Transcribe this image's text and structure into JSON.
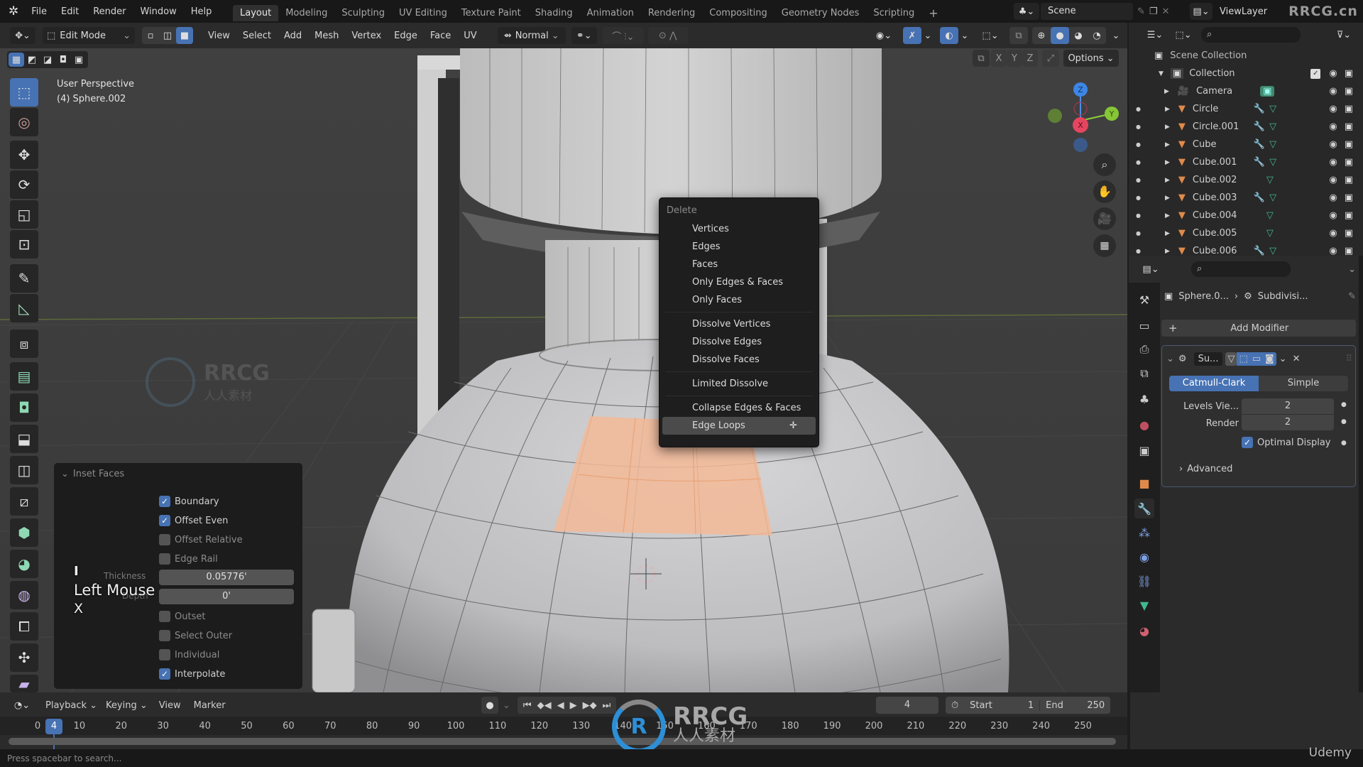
{
  "topbar": {
    "menus": [
      "File",
      "Edit",
      "Render",
      "Window",
      "Help"
    ],
    "workspaces": [
      "Layout",
      "Modeling",
      "Sculpting",
      "UV Editing",
      "Texture Paint",
      "Shading",
      "Animation",
      "Rendering",
      "Compositing",
      "Geometry Nodes",
      "Scripting"
    ],
    "active_workspace": "Layout",
    "add_workspace": "+",
    "scene_label": "Scene",
    "viewlayer_label": "ViewLayer",
    "watermark": "RRCG.cn"
  },
  "header": {
    "mode": "Edit Mode",
    "menus": [
      "View",
      "Select",
      "Add",
      "Mesh",
      "Vertex",
      "Edge",
      "Face",
      "UV"
    ],
    "transform_orientation": "Normal",
    "options_label": "Options",
    "axis_x": "X",
    "axis_y": "Y",
    "axis_z": "Z"
  },
  "viewport": {
    "view_name": "User Perspective",
    "object_info": "(4) Sphere.002",
    "watermark_text": "RRCG",
    "watermark_sub": "人人素材",
    "gizmo": {
      "x": "X",
      "y": "Y",
      "z": "Z"
    }
  },
  "delete_menu": {
    "title": "Delete",
    "groups": [
      [
        "Vertices",
        "Edges",
        "Faces",
        "Only Edges & Faces",
        "Only Faces"
      ],
      [
        "Dissolve Vertices",
        "Dissolve Edges",
        "Dissolve Faces"
      ],
      [
        "Limited Dissolve"
      ],
      [
        "Collapse Edges & Faces",
        "Edge Loops"
      ]
    ],
    "hovered": "Edge Loops"
  },
  "inset_panel": {
    "title": "Inset Faces",
    "options": [
      {
        "label": "Boundary",
        "checked": true
      },
      {
        "label": "Offset Even",
        "checked": true
      },
      {
        "label": "Offset Relative",
        "checked": false
      },
      {
        "label": "Edge Rail",
        "checked": false
      }
    ],
    "thickness_label": "Thickness",
    "thickness_value": "0.05776'",
    "depth_label": "Depth",
    "depth_value": "0'",
    "options2": [
      {
        "label": "Outset",
        "checked": false
      },
      {
        "label": "Select Outer",
        "checked": false
      },
      {
        "label": "Individual",
        "checked": false
      },
      {
        "label": "Interpolate",
        "checked": true
      }
    ],
    "key_overlay": [
      "I",
      "Left Mouse",
      "X"
    ]
  },
  "outliner": {
    "scene_collection": "Scene Collection",
    "collection": "Collection",
    "items": [
      {
        "name": "Camera",
        "type": "camera",
        "modifier": false,
        "mesh": false
      },
      {
        "name": "Circle",
        "type": "mesh",
        "modifier": true,
        "mesh": true
      },
      {
        "name": "Circle.001",
        "type": "mesh",
        "modifier": true,
        "mesh": true
      },
      {
        "name": "Cube",
        "type": "mesh",
        "modifier": true,
        "mesh": true
      },
      {
        "name": "Cube.001",
        "type": "mesh",
        "modifier": true,
        "mesh": true
      },
      {
        "name": "Cube.002",
        "type": "mesh",
        "modifier": false,
        "mesh": true
      },
      {
        "name": "Cube.003",
        "type": "mesh",
        "modifier": true,
        "mesh": true
      },
      {
        "name": "Cube.004",
        "type": "mesh",
        "modifier": false,
        "mesh": true
      },
      {
        "name": "Cube.005",
        "type": "mesh",
        "modifier": false,
        "mesh": true
      },
      {
        "name": "Cube.006",
        "type": "mesh",
        "modifier": true,
        "mesh": true
      }
    ]
  },
  "properties": {
    "breadcrumb_object": "Sphere.0...",
    "breadcrumb_modifier": "Subdivisi...",
    "add_modifier": "Add Modifier",
    "modifier_name": "Su...",
    "algo_options": [
      "Catmull-Clark",
      "Simple"
    ],
    "algo_selected": "Catmull-Clark",
    "levels_label": "Levels Vie...",
    "levels_value": "2",
    "render_label": "Render",
    "render_value": "2",
    "optimal_display": "Optimal Display",
    "optimal_checked": true,
    "advanced": "Advanced"
  },
  "timeline": {
    "menus": [
      "Playback",
      "Keying",
      "View",
      "Marker"
    ],
    "current_frame": "4",
    "start_label": "Start",
    "start_value": "1",
    "end_label": "End",
    "end_value": "250",
    "ticks": [
      "0",
      "10",
      "20",
      "30",
      "40",
      "50",
      "60",
      "70",
      "80",
      "90",
      "100",
      "110",
      "120",
      "130",
      "140",
      "150",
      "160",
      "170",
      "180",
      "190",
      "200",
      "210",
      "220",
      "230",
      "240",
      "250"
    ]
  },
  "status": {
    "hint": "Press spacebar to search...",
    "brand": "Udemy"
  },
  "colors": {
    "accent": "#4772b3",
    "selection_face": "#f0b492",
    "mesh_icon": "#e08a4a",
    "data_icon": "#3fb88e",
    "modifier_icon": "#6b8cd6"
  }
}
